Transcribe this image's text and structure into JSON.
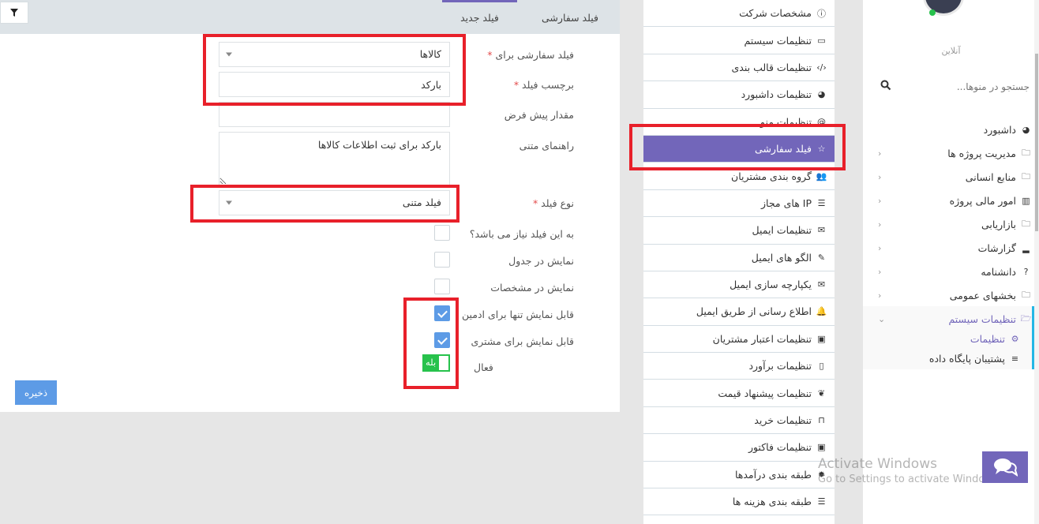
{
  "tabs": {
    "custom_field": "فیلد سفارشی",
    "new_field": "فیلد جدید"
  },
  "form": {
    "custom_field_for": {
      "label": "فیلد سفارشی برای",
      "value": "کالاها",
      "required_mark": "*"
    },
    "field_label": {
      "label": "برچسب فیلد",
      "value": "بارکد",
      "required_mark": "*"
    },
    "default_value": {
      "label": "مقدار پیش فرض",
      "value": ""
    },
    "help_text": {
      "label": "راهنمای متنی",
      "value": "بارکد برای ثبت اطلاعات کالاها"
    },
    "field_type": {
      "label": "نوع فیلد",
      "value": "فیلد متنی",
      "required_mark": "*"
    },
    "checkboxes": [
      {
        "label": "به این فیلد نیاز می باشد؟",
        "checked": false
      },
      {
        "label": "نمایش در جدول",
        "checked": false
      },
      {
        "label": "نمایش در مشخصات",
        "checked": false
      },
      {
        "label": "قابل نمایش تنها برای ادمین",
        "checked": true
      },
      {
        "label": "قابل نمایش برای مشتری",
        "checked": true
      }
    ],
    "active": {
      "label": "فعال",
      "toggle_text": "بله",
      "on": true
    },
    "save_label": "ذخیره"
  },
  "settings_menu": {
    "items": [
      {
        "label": "مشخصات شرکت",
        "icon": "info-circle-icon"
      },
      {
        "label": "تنظیمات سیستم",
        "icon": "monitor-icon"
      },
      {
        "label": "تنظیمات قالب بندی",
        "icon": "code-icon"
      },
      {
        "label": "تنظیمات داشبورد",
        "icon": "dashboard-icon"
      },
      {
        "label": "تنظیمات منو",
        "icon": "at-icon"
      },
      {
        "label": "فیلد سفارشی",
        "icon": "star-icon",
        "active": true
      },
      {
        "label": "گروه بندی مشتریان",
        "icon": "users-icon"
      },
      {
        "label": "IP های مجاز",
        "icon": "server-icon"
      },
      {
        "label": "تنظیمات ایمیل",
        "icon": "envelope-icon"
      },
      {
        "label": "الگو های ایمیل",
        "icon": "edit-icon"
      },
      {
        "label": "یکپارچه سازی ایمیل",
        "icon": "envelope-outline-icon"
      },
      {
        "label": "اطلاع رسانی از طریق ایمیل",
        "icon": "bell-icon"
      },
      {
        "label": "تنظیمات اعتبار مشتریان",
        "icon": "money-icon"
      },
      {
        "label": "تنظیمات برآورد",
        "icon": "file-icon"
      },
      {
        "label": "تنظیمات پیشنهاد قیمت",
        "icon": "leaf-icon"
      },
      {
        "label": "تنظیمات خرید",
        "icon": "shopping-bag-icon"
      },
      {
        "label": "تنظیمات فاکتور",
        "icon": "money-icon"
      },
      {
        "label": "طبقه بندی درآمدها",
        "icon": "cog-icon"
      },
      {
        "label": "طبقه بندی هزینه ها",
        "icon": "server-icon"
      }
    ]
  },
  "sidebar": {
    "status": "آنلاین",
    "search_placeholder": "جستجو در منوها...",
    "items": [
      {
        "label": "داشبورد",
        "icon": "dashboard-icon",
        "has_children": false
      },
      {
        "label": "مدیریت پروژه ها",
        "icon": "folder-icon",
        "has_children": true
      },
      {
        "label": "منابع انسانی",
        "icon": "folder-icon",
        "has_children": true
      },
      {
        "label": "امور مالی پروژه",
        "icon": "building-icon",
        "has_children": true
      },
      {
        "label": "بازاریابی",
        "icon": "folder-icon",
        "has_children": true
      },
      {
        "label": "گزارشات",
        "icon": "bar-chart-icon",
        "has_children": true
      },
      {
        "label": "دانشنامه",
        "icon": "question-circle-icon",
        "has_children": true
      },
      {
        "label": "بخشهای عمومی",
        "icon": "folder-icon",
        "has_children": true
      },
      {
        "label": "تنظیمات سیستم",
        "icon": "folder-open-icon",
        "has_children": true,
        "open": true
      }
    ],
    "sub_items": [
      {
        "label": "تنظیمات",
        "icon": "cogs-icon",
        "current": true
      },
      {
        "label": "پشتیبان پایگاه داده",
        "icon": "database-icon"
      }
    ]
  },
  "watermark": {
    "title": "Activate Windows",
    "subtitle": "Go to Settings to activate Windows."
  },
  "colors": {
    "accent": "#7266ba",
    "primary_button": "#5d9be6",
    "toggle_on": "#27c24c",
    "highlight_box": "#e8202a",
    "active_indicator": "#23b7e5"
  }
}
